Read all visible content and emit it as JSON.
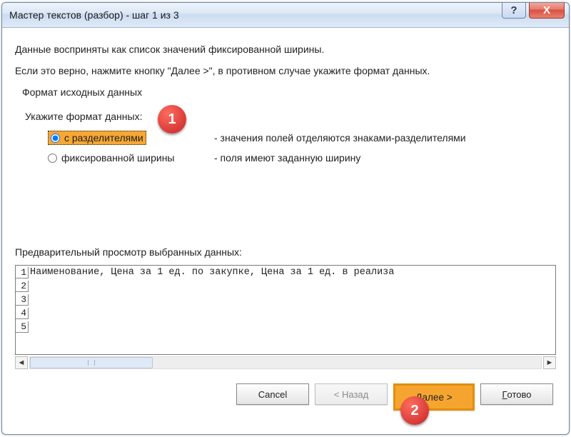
{
  "window": {
    "title": "Мастер текстов (разбор) - шаг 1 из 3",
    "help": "?",
    "close": "X"
  },
  "intro": {
    "line1": "Данные восприняты как список значений фиксированной ширины.",
    "line2": "Если это верно, нажмите кнопку \"Далее >\", в противном случае укажите формат данных."
  },
  "group": {
    "title": "Формат исходных данных",
    "subtitle": "Укажите формат данных:"
  },
  "options": {
    "opt1": {
      "label": "с разделителями",
      "desc": "- значения полей отделяются знаками-разделителями"
    },
    "opt2": {
      "label": "фиксированной ширины",
      "desc": "- поля имеют заданную ширину"
    }
  },
  "markers": {
    "m1": "1",
    "m2": "2"
  },
  "preview": {
    "label": "Предварительный просмотр выбранных данных:",
    "rows": {
      "n1": "1",
      "n2": "2",
      "n3": "3",
      "n4": "4",
      "n5": "5",
      "r1": "Наименование, Цена за 1 ед. по закупке, Цена за 1 ед. в реализа"
    }
  },
  "buttons": {
    "cancel": "Cancel",
    "back": "< Назад",
    "next": "Далее >",
    "finish_pre": "Г",
    "finish_rest": "отово"
  }
}
